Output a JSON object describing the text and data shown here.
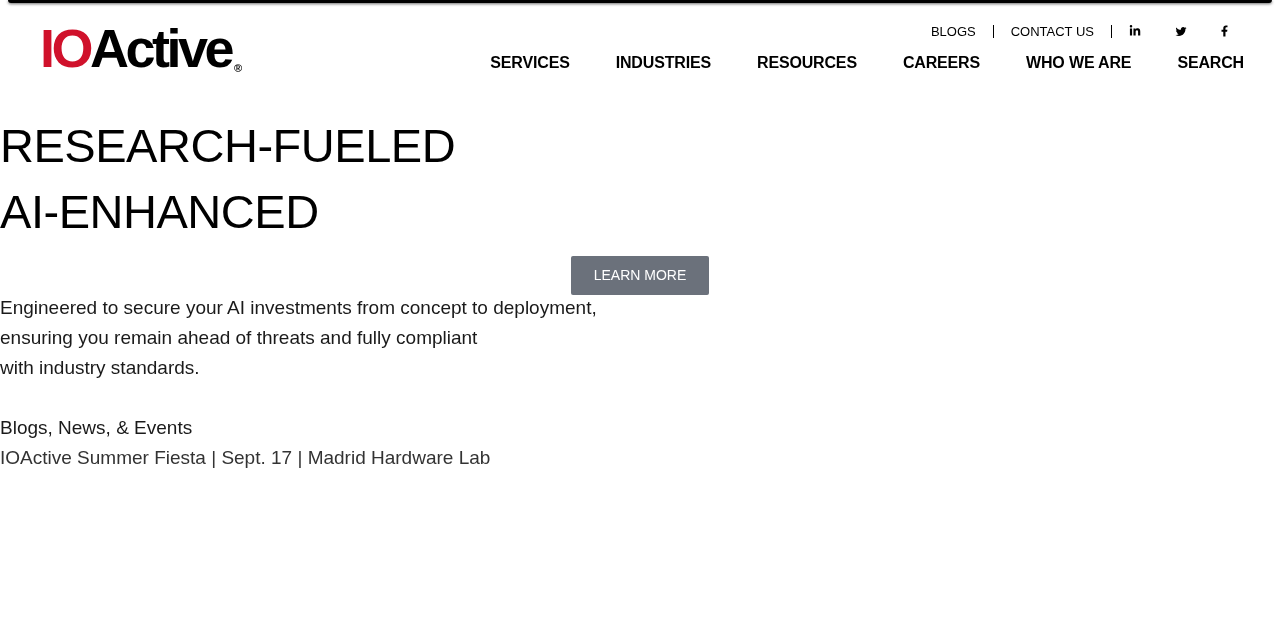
{
  "logo": {
    "accent": "IO",
    "text": "Active",
    "mark": "®"
  },
  "utility_links": [
    "BLOGS",
    "CONTACT US"
  ],
  "nav": [
    "SERVICES",
    "INDUSTRIES",
    "RESOURCES",
    "CAREERS",
    "WHO WE ARE",
    "SEARCH"
  ],
  "hero": {
    "headline": [
      "RESEARCH-FUELED",
      "AI-ENHANCED"
    ],
    "button": "LEARN MORE",
    "description": [
      "Engineered to secure your AI investments from concept to deployment,",
      "ensuring you remain ahead of threats and fully compliant",
      "with industry standards."
    ]
  },
  "news": {
    "heading": "Blogs, News, & Events",
    "items": [
      "IOActive Summer Fiesta | Sept. 17 | Madrid Hardware Lab"
    ]
  }
}
